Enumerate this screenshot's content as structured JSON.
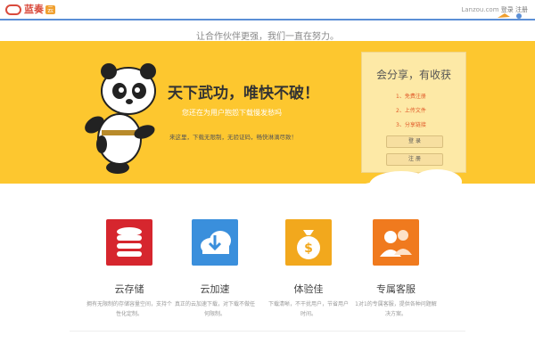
{
  "header": {
    "logo_text": "蓝奏",
    "logo_badge": "云",
    "site_domain": "Lanzou.com",
    "login_label": "登录",
    "register_label": "注册"
  },
  "slogan": "让合作伙伴更强，我们一直在努力。",
  "hero": {
    "title": "天下武功，唯快不破！",
    "subtitle": "您还在为用户抱怨下载慢发愁吗",
    "description": "来这里，下载无限制，无验证码，畅快淋漓尽致！"
  },
  "share_panel": {
    "title": "会分享，有收获",
    "steps": [
      "1、免费注册",
      "2、上传文件",
      "3、分享链接"
    ],
    "login_button": "登 录",
    "register_button": "注 册"
  },
  "features": [
    {
      "name": "云存储",
      "description_lines": [
        "拥有无限制的存储容量空间，支持个",
        "性化定制。"
      ],
      "icon": "database-icon",
      "color": "#d6262e"
    },
    {
      "name": "云加速",
      "description_lines": [
        "真正的云加速下载，对下载不做任",
        "何限制。"
      ],
      "icon": "cloud-download-icon",
      "color": "#3a8fdc"
    },
    {
      "name": "体验佳",
      "description_lines": [
        "下载清晰，不干扰用户，节省用户",
        "时间。"
      ],
      "icon": "money-bag-icon",
      "color": "#f2a81d"
    },
    {
      "name": "专属客服",
      "description_lines": [
        "1对1的专属客服，提供各种问题解",
        "决方案。"
      ],
      "icon": "customer-service-icon",
      "color": "#f07a1e"
    }
  ],
  "colors": {
    "hero_bg": "#fdc72f",
    "accent_red": "#d94a3c",
    "top_line": "#5b8fd6"
  }
}
